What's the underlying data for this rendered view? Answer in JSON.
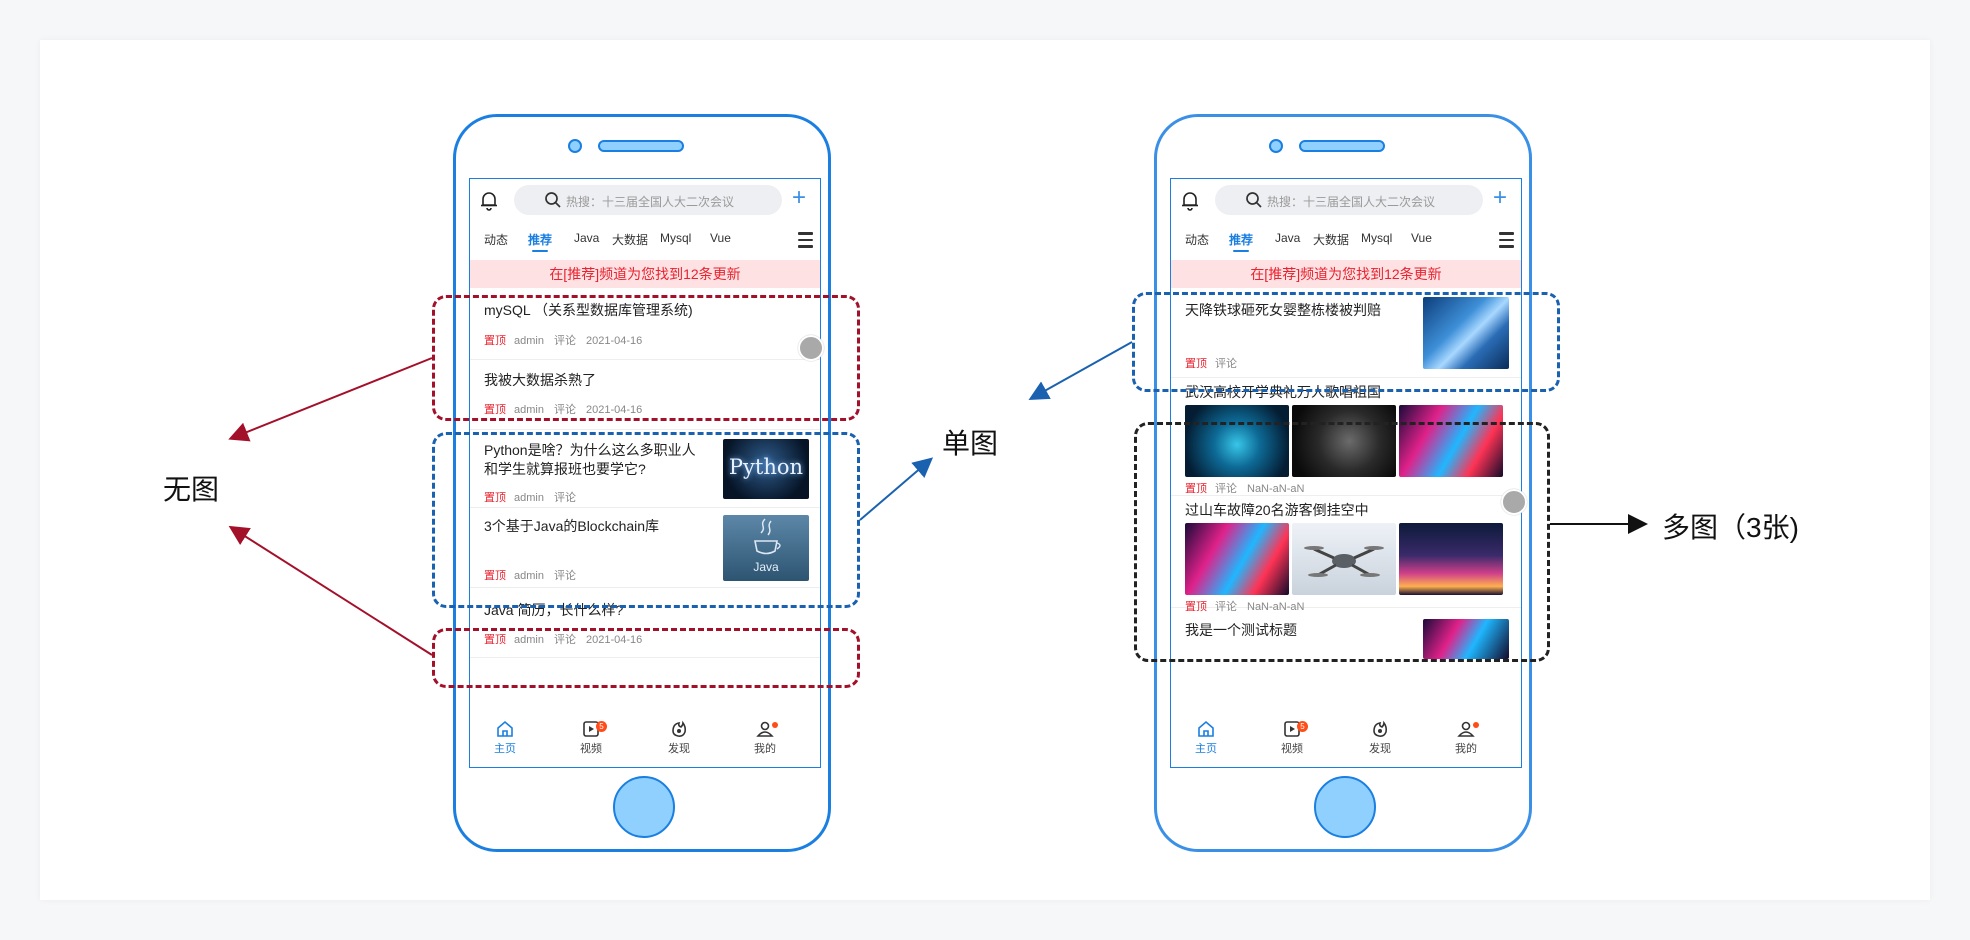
{
  "annotations": {
    "no_image": "无图",
    "single_image": "单图",
    "multi_image": "多图（3张)"
  },
  "colors": {
    "accent": "#1a7fe0",
    "top_tag": "#e8232f",
    "notice_bg": "#fde1e3",
    "red_dash": "#a3102a",
    "blue_dash": "#1a62b0",
    "black_dash": "#222222"
  },
  "phone1": {
    "search_placeholder": "热搜：十三届全国人大二次会议",
    "tabs": [
      "动态",
      "推荐",
      "Java",
      "大数据",
      "Mysql",
      "Vue"
    ],
    "active_tab": "推荐",
    "notice": "在[推荐]频道为您找到12条更新",
    "items": [
      {
        "title": "mySQL （关系型数据库管理系统)",
        "tag": "置顶",
        "author": "admin",
        "comments": "评论",
        "date": "2021-04-16"
      },
      {
        "title": "我被大数据杀熟了",
        "tag": "置顶",
        "author": "admin",
        "comments": "评论",
        "date": "2021-04-16"
      },
      {
        "title": "Python是啥？为什么这么多职业人和学生就算报班也要学它?",
        "tag": "置顶",
        "author": "admin",
        "comments": "评论",
        "thumb_text": "Python"
      },
      {
        "title": "3个基于Java的Blockchain库",
        "tag": "置顶",
        "author": "admin",
        "comments": "评论",
        "thumb_text": "Java"
      },
      {
        "title": "Java 简历，长什么样?",
        "tag": "置顶",
        "author": "admin",
        "comments": "评论",
        "date": "2021-04-16"
      }
    ],
    "nav": [
      {
        "label": "主页",
        "icon": "home-icon"
      },
      {
        "label": "视频",
        "icon": "video-icon",
        "badge": "5"
      },
      {
        "label": "发现",
        "icon": "discover-icon"
      },
      {
        "label": "我的",
        "icon": "profile-icon"
      }
    ]
  },
  "phone2": {
    "search_placeholder": "热搜：十三届全国人大二次会议",
    "tabs": [
      "动态",
      "推荐",
      "Java",
      "大数据",
      "Mysql",
      "Vue"
    ],
    "active_tab": "推荐",
    "notice": "在[推荐]频道为您找到12条更新",
    "items": [
      {
        "title": "天降铁球砸死女婴整栋楼被判赔",
        "tag": "置顶",
        "comments": "评论"
      },
      {
        "title": "武汉高校开学典礼万人歌唱祖国",
        "tag": "置顶",
        "comments": "评论",
        "date": "NaN-aN-aN"
      },
      {
        "title": "过山车故障20名游客倒挂空中",
        "tag": "置顶",
        "comments": "评论",
        "date": "NaN-aN-aN"
      },
      {
        "title": "我是一个测试标题"
      }
    ],
    "nav": [
      {
        "label": "主页",
        "icon": "home-icon"
      },
      {
        "label": "视频",
        "icon": "video-icon",
        "badge": "5"
      },
      {
        "label": "发现",
        "icon": "discover-icon"
      },
      {
        "label": "我的",
        "icon": "profile-icon"
      }
    ]
  }
}
